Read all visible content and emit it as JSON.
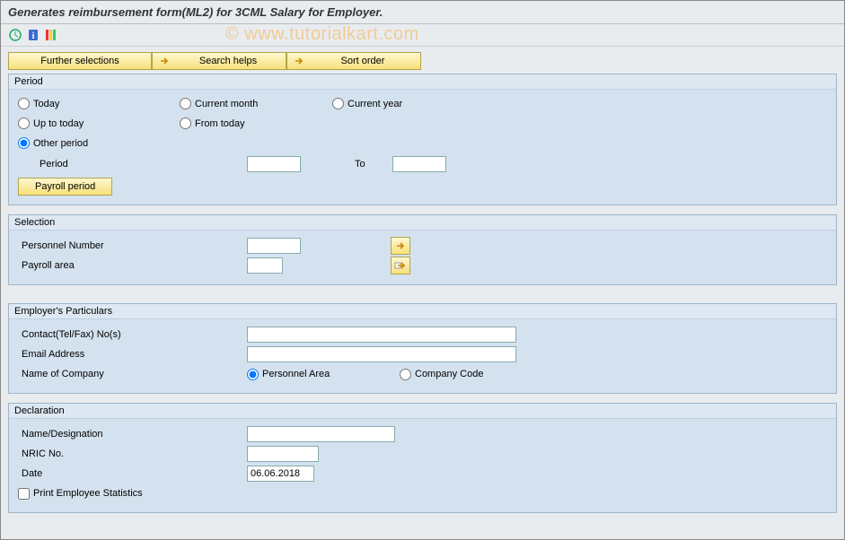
{
  "title": "Generates reimbursement form(ML2) for 3CML Salary for Employer.",
  "watermark": "© www.tutorialkart.com",
  "buttons": {
    "further": "Further selections",
    "search": "Search helps",
    "sort": "Sort order",
    "payroll": "Payroll period"
  },
  "period": {
    "title": "Period",
    "today": "Today",
    "current_month": "Current month",
    "current_year": "Current year",
    "up_to_today": "Up to today",
    "from_today": "From today",
    "other_period": "Other period",
    "period_label": "Period",
    "period_from": "",
    "to_label": "To",
    "period_to": ""
  },
  "selection": {
    "title": "Selection",
    "personnel_number_label": "Personnel Number",
    "personnel_number_value": "",
    "payroll_area_label": "Payroll area",
    "payroll_area_value": ""
  },
  "employer": {
    "title": "Employer's Particulars",
    "contact_label": "Contact(Tel/Fax) No(s)",
    "contact_value": "",
    "email_label": "Email Address",
    "email_value": "",
    "company_label": "Name of Company",
    "personnel_area": "Personnel Area",
    "company_code": "Company Code"
  },
  "declaration": {
    "title": "Declaration",
    "name_label": "Name/Designation",
    "name_value": "",
    "nric_label": "NRIC No.",
    "nric_value": "",
    "date_label": "Date",
    "date_value": "06.06.2018",
    "print_stats": "Print Employee Statistics"
  }
}
